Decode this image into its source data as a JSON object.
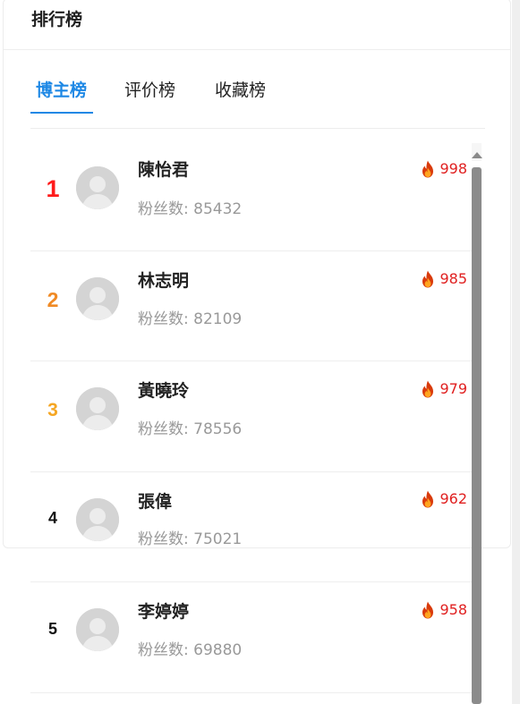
{
  "panel": {
    "title": "排行榜"
  },
  "tabs": [
    {
      "label": "博主榜",
      "active": true
    },
    {
      "label": "评价榜",
      "active": false
    },
    {
      "label": "收藏榜",
      "active": false
    }
  ],
  "fans_label": "粉丝数:",
  "colors": {
    "accent": "#1e88e5",
    "heat": "#e02020",
    "rank1": "#ff1b1b",
    "rank2": "#f08a24",
    "rank3": "#f5a623"
  },
  "bloggers": [
    {
      "rank": "1",
      "name": "陳怡君",
      "fans": "85432",
      "heat": "998"
    },
    {
      "rank": "2",
      "name": "林志明",
      "fans": "82109",
      "heat": "985"
    },
    {
      "rank": "3",
      "name": "黃曉玲",
      "fans": "78556",
      "heat": "979"
    },
    {
      "rank": "4",
      "name": "張偉",
      "fans": "75021",
      "heat": "962"
    },
    {
      "rank": "5",
      "name": "李婷婷",
      "fans": "69880",
      "heat": "958"
    }
  ],
  "icons": {
    "avatar": "default-user-avatar-icon",
    "heat": "fire-icon",
    "scroll": "scroll-up-arrow-icon"
  }
}
